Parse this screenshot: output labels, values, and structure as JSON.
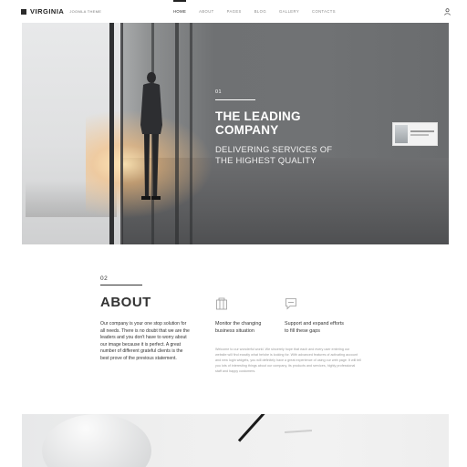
{
  "header": {
    "logo_name": "VIRGINIA",
    "logo_tag": "JOOMLA THEME",
    "nav": [
      {
        "label": "HOME",
        "active": true
      },
      {
        "label": "ABOUT",
        "active": false
      },
      {
        "label": "PAGES",
        "active": false
      },
      {
        "label": "BLOG",
        "active": false
      },
      {
        "label": "GALLERY",
        "active": false
      },
      {
        "label": "CONTACTS",
        "active": false
      }
    ],
    "user_icon": "user-icon"
  },
  "hero": {
    "slide_number": "01",
    "title": "THE LEADING COMPANY",
    "subtitle": "DELIVERING SERVICES OF THE HIGHEST QUALITY",
    "next_arrow": "›"
  },
  "about": {
    "number": "02",
    "title": "ABOUT",
    "text": "Our company is your one stop solution for all needs. There is no doubt that we are the leaders and you don't have to worry about our image because it is perfect. A great number of different grateful clients is the best prove of the previous statement.",
    "features": [
      {
        "icon": "building-icon",
        "label": "Monitor the changing business situation"
      },
      {
        "icon": "chat-icon",
        "label": "Support and expand efforts to fill these gaps"
      }
    ],
    "description": "Welcome to our wonderful world. We sincerely hope that each and every user entering our website will find exactly what he/she is looking for. With advanced features of activating account and new login widgets, you will definitely have a great experience of using our web page. It will tell you lots of interesting things about our company, its products and services, highly professional staff and happy customers."
  },
  "colors": {
    "accent": "#222222",
    "text": "#333333",
    "muted": "#999999"
  }
}
